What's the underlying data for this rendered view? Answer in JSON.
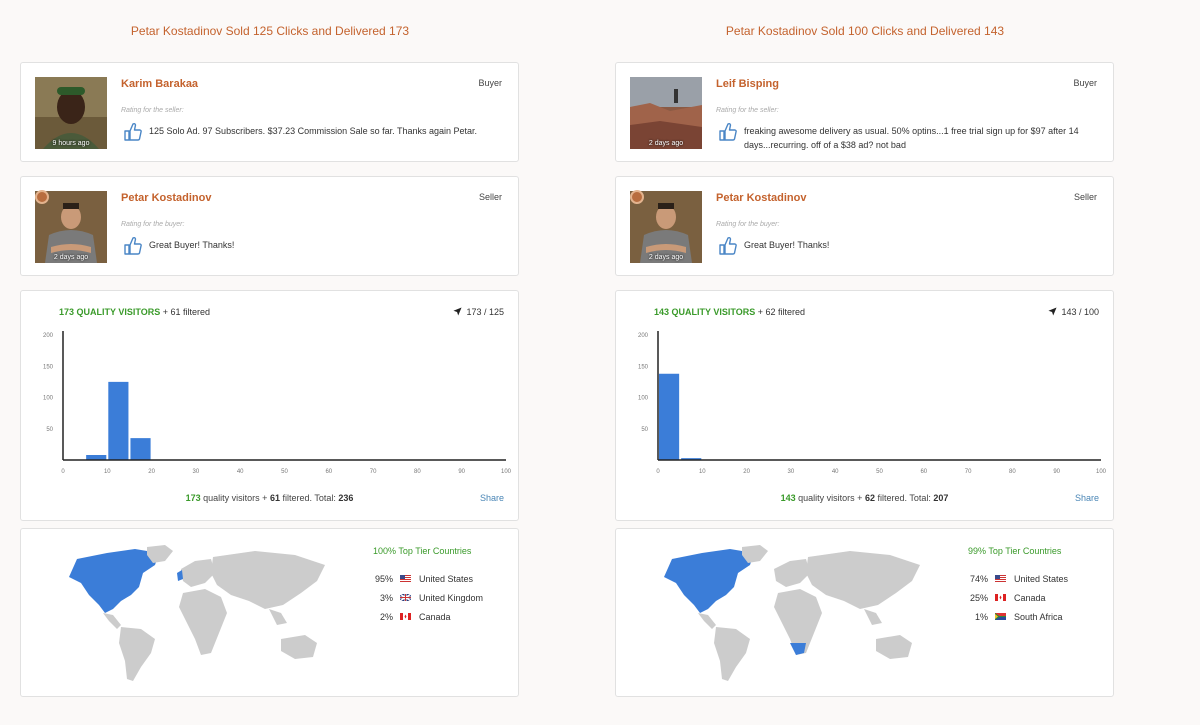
{
  "colors": {
    "accent_orange": "#c4622d",
    "green": "#3a9a2a",
    "bar_blue": "#3b7dd8",
    "map_gray": "#cccccc",
    "link_blue": "#4a86b6"
  },
  "columns": [
    {
      "title": "Petar Kostadinov Sold 125 Clicks and Delivered 173",
      "reviews": [
        {
          "name": "Karim Barakaa",
          "role": "Buyer",
          "rating_for": "Rating for the seller:",
          "ago": "9 hours ago",
          "text": "125 Solo Ad. 97 Subscribers. $37.23 Commission Sale so far. Thanks again Petar.",
          "thumb_icon": "thumbs-up-icon"
        },
        {
          "name": "Petar Kostadinov",
          "role": "Seller",
          "rating_for": "Rating for the buyer:",
          "ago": "2 days ago",
          "text": "Great Buyer! Thanks!",
          "thumb_icon": "thumbs-up-icon"
        }
      ],
      "stats": {
        "quality": "173",
        "quality_label": "QUALITY VISITORS",
        "filtered_text": "+ 61 filtered",
        "ratio": "173 / 125",
        "total_quality": "173",
        "total_filtered": "61",
        "total": "236",
        "quality_visitors_text": "quality visitors +",
        "filtered_total_text": "filtered. Total:",
        "share": "Share"
      },
      "tier_label": "100% Top Tier Countries",
      "countries": [
        {
          "pct": "95%",
          "name": "United States",
          "flag": "us-flag-icon"
        },
        {
          "pct": "3%",
          "name": "United Kingdom",
          "flag": "uk-flag-icon"
        },
        {
          "pct": "2%",
          "name": "Canada",
          "flag": "ca-flag-icon"
        }
      ],
      "highlighted_regions": [
        "United States",
        "Canada",
        "United Kingdom"
      ],
      "chart_data": {
        "type": "bar",
        "bin_width": 5,
        "x": [
          5,
          10,
          15
        ],
        "values": [
          8,
          125,
          35
        ],
        "xlim": [
          0,
          100
        ],
        "ylim": [
          0,
          200
        ],
        "xticks": [
          0,
          10,
          20,
          30,
          40,
          50,
          60,
          70,
          80,
          90,
          100
        ],
        "yticks": [
          50,
          100,
          150,
          200
        ]
      }
    },
    {
      "title": "Petar Kostadinov Sold 100 Clicks and Delivered 143",
      "reviews": [
        {
          "name": "Leif Bisping",
          "role": "Buyer",
          "rating_for": "Rating for the seller:",
          "ago": "2 days ago",
          "text": "freaking awesome delivery as usual. 50% optins...1 free trial sign up for $97 after 14 days...recurring. off of a $38 ad? not bad",
          "thumb_icon": "thumbs-up-icon"
        },
        {
          "name": "Petar Kostadinov",
          "role": "Seller",
          "rating_for": "Rating for the buyer:",
          "ago": "2 days ago",
          "text": "Great Buyer! Thanks!",
          "thumb_icon": "thumbs-up-icon"
        }
      ],
      "stats": {
        "quality": "143",
        "quality_label": "QUALITY VISITORS",
        "filtered_text": "+ 62 filtered",
        "ratio": "143 / 100",
        "total_quality": "143",
        "total_filtered": "62",
        "total": "207",
        "quality_visitors_text": "quality visitors +",
        "filtered_total_text": "filtered. Total:",
        "share": "Share"
      },
      "tier_label": "99% Top Tier Countries",
      "countries": [
        {
          "pct": "74%",
          "name": "United States",
          "flag": "us-flag-icon"
        },
        {
          "pct": "25%",
          "name": "Canada",
          "flag": "ca-flag-icon"
        },
        {
          "pct": "1%",
          "name": "South Africa",
          "flag": "za-flag-icon"
        }
      ],
      "highlighted_regions": [
        "United States",
        "Canada",
        "South Africa"
      ],
      "chart_data": {
        "type": "bar",
        "bin_width": 5,
        "x": [
          0,
          5
        ],
        "values": [
          138,
          3
        ],
        "xlim": [
          0,
          100
        ],
        "ylim": [
          0,
          200
        ],
        "xticks": [
          0,
          10,
          20,
          30,
          40,
          50,
          60,
          70,
          80,
          90,
          100
        ],
        "yticks": [
          50,
          100,
          150,
          200
        ]
      }
    }
  ]
}
